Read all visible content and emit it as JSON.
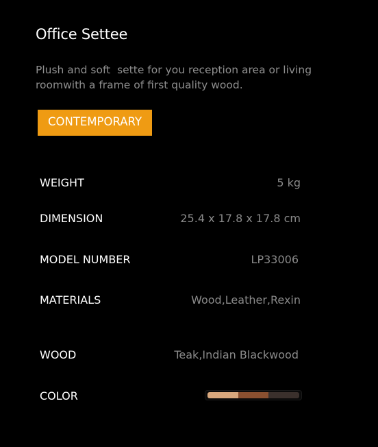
{
  "product": {
    "title": "Office Settee",
    "description": "Plush and soft  sette for you reception area or living roomwith a frame of first quality wood.",
    "badge": "CONTEMPORARY"
  },
  "specs": {
    "weight": {
      "label": "WEIGHT",
      "value": "5 kg"
    },
    "dimension": {
      "label": "DIMENSION",
      "value": "25.4 x 17.8 x 17.8 cm"
    },
    "model_number": {
      "label": "MODEL NUMBER",
      "value": "LP33006"
    },
    "materials": {
      "label": "MATERIALS",
      "value": "Wood,Leather,Rexin"
    },
    "wood": {
      "label": "WOOD",
      "value": "Teak,Indian Blackwood"
    },
    "color": {
      "label": "COLOR"
    }
  },
  "colors": {
    "accent": "#ef9b13",
    "swatches": [
      "#d9a87d",
      "#8a5030",
      "#3a302c"
    ]
  }
}
